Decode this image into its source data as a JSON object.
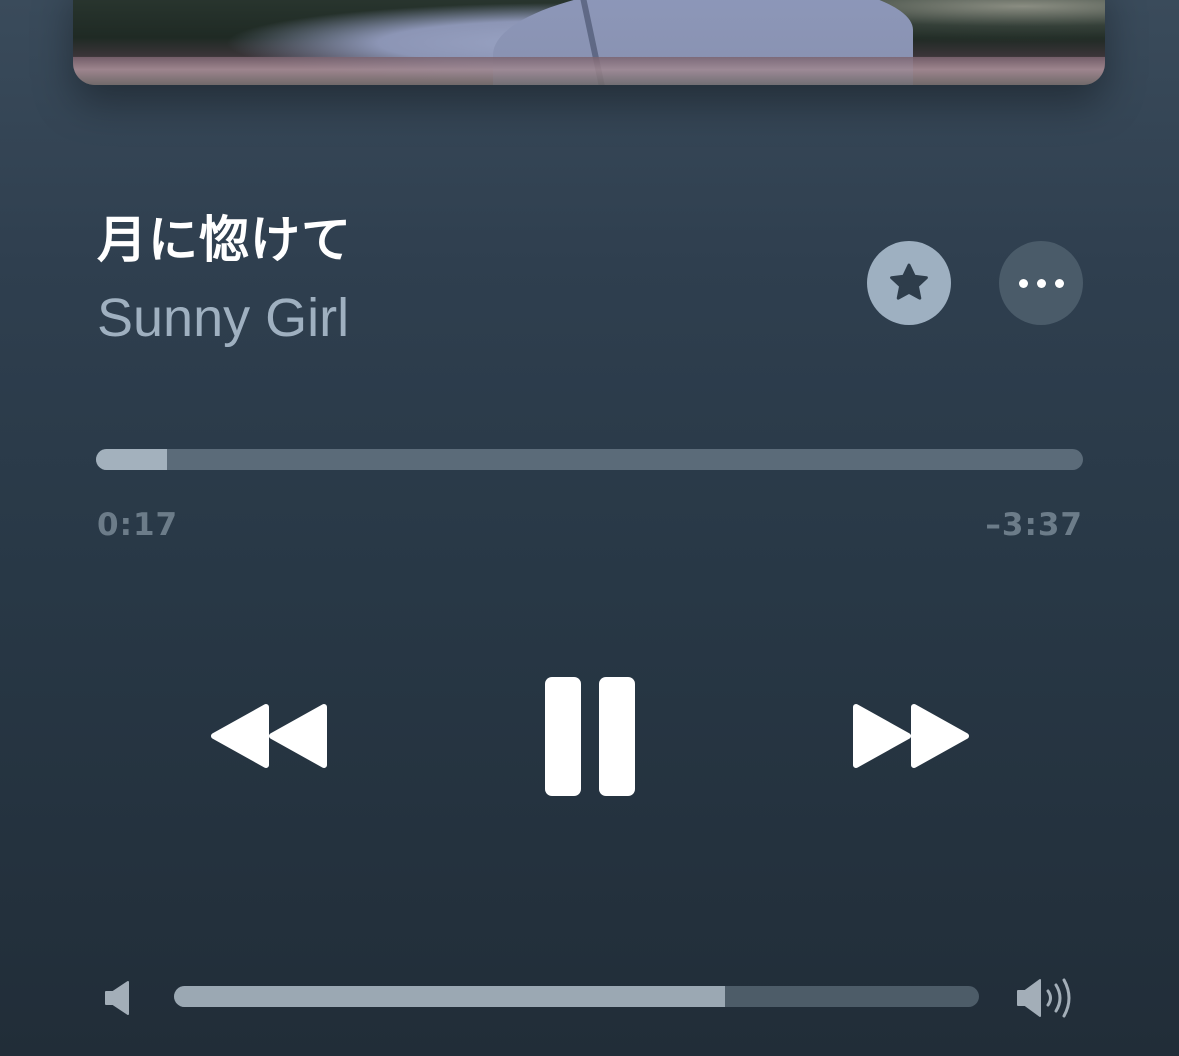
{
  "now_playing": {
    "title": "月に惚けて",
    "artist": "Sunny Girl"
  },
  "actions": {
    "favorite_icon": "star-icon",
    "more_icon": "ellipsis-icon"
  },
  "progress": {
    "elapsed": "0:17",
    "remaining": "–3:37",
    "fraction": 0.072
  },
  "transport": {
    "rewind_icon": "rewind-icon",
    "pause_icon": "pause-icon",
    "forward_icon": "fast-forward-icon"
  },
  "volume": {
    "level": 0.685,
    "min_icon": "speaker-low-icon",
    "max_icon": "speaker-high-icon"
  },
  "colors": {
    "background_top": "#3a4b5b",
    "background_bottom": "#212d38",
    "artist_text": "#9fb0c0",
    "favorite_button": "#9eb0c1",
    "more_button": "#4a5b69"
  }
}
